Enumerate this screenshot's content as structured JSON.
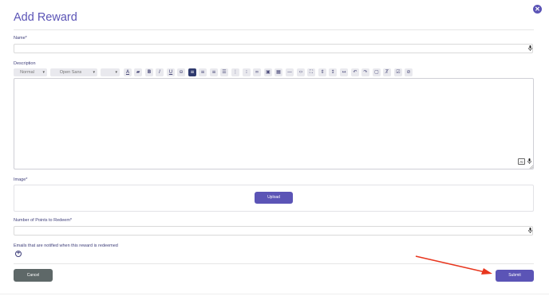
{
  "dialog": {
    "title": "Add Reward",
    "close_icon": "close-icon"
  },
  "fields": {
    "name_label": "Name*",
    "name_value": "",
    "description_label": "Description",
    "image_label": "Image*",
    "points_label": "Number of Points to Redeem*",
    "points_value": "",
    "emails_label": "Emails that are notified when this reward is redeemed"
  },
  "toolbar": {
    "format_select": "Normal",
    "font_select": "Open Sans",
    "size_select": "",
    "buttons": [
      "font-color-icon",
      "highlight-icon",
      "bold-icon",
      "italic-icon",
      "underline-icon",
      "strikethrough-icon",
      "align-left-icon",
      "align-center-icon",
      "align-right-icon",
      "align-justify-icon",
      "ordered-list-icon",
      "unordered-list-icon",
      "link-icon",
      "image-icon",
      "table-icon",
      "horizontal-rule-icon",
      "code-icon",
      "fullscreen-icon",
      "sort-icon",
      "line-height-icon",
      "text-width-icon",
      "undo-icon",
      "redo-icon",
      "select-all-icon",
      "clear-format-icon",
      "checklist-icon",
      "disable-icon"
    ]
  },
  "editor": {
    "ai_badge": "AI"
  },
  "buttons": {
    "upload": "Upload",
    "cancel": "Cancel",
    "submit": "Submit"
  },
  "colors": {
    "accent": "#5b54b6",
    "cancel": "#5e6868",
    "arrow": "#e8361e"
  }
}
